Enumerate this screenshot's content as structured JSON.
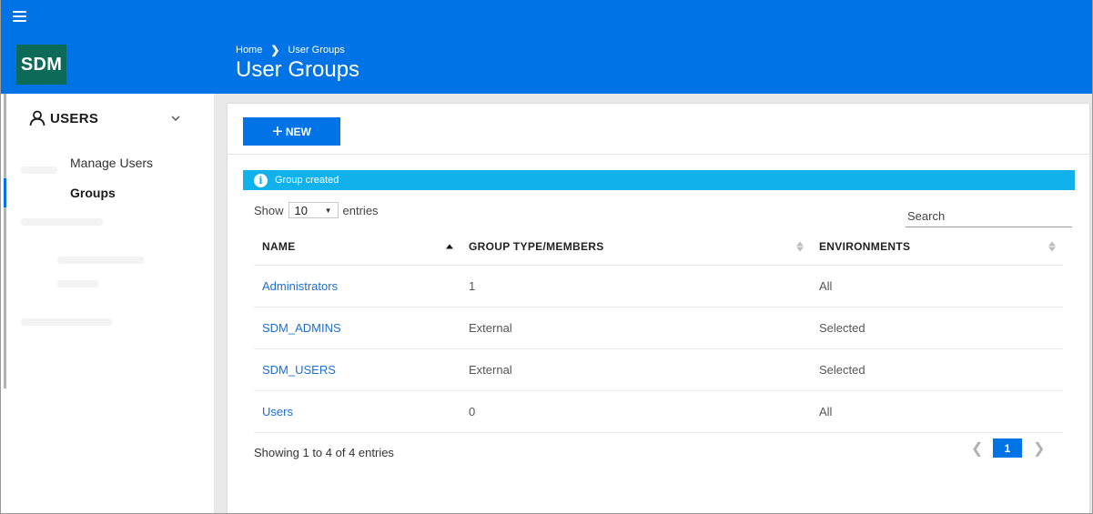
{
  "header": {
    "logo": "SDM",
    "breadcrumb": {
      "home": "Home",
      "current": "User Groups"
    },
    "title": "User Groups"
  },
  "sidebar": {
    "section_label": "USERS",
    "items": [
      {
        "label": "Manage Users",
        "active": false
      },
      {
        "label": "Groups",
        "active": true
      }
    ]
  },
  "toolbar": {
    "new_label": "NEW"
  },
  "alert": {
    "message": "Group created"
  },
  "length": {
    "show": "Show",
    "value": "10",
    "entries": "entries"
  },
  "search": {
    "placeholder": "Search"
  },
  "table": {
    "columns": [
      "NAME",
      "GROUP TYPE/MEMBERS",
      "ENVIRONMENTS"
    ],
    "rows": [
      {
        "name": "Administrators",
        "type": "1",
        "env": "All"
      },
      {
        "name": "SDM_ADMINS",
        "type": "External",
        "env": "Selected"
      },
      {
        "name": "SDM_USERS",
        "type": "External",
        "env": "Selected"
      },
      {
        "name": "Users",
        "type": "0",
        "env": "All"
      }
    ]
  },
  "footer": {
    "info": "Showing 1 to 4 of 4 entries",
    "current_page": "1"
  },
  "colors": {
    "primary": "#0073e6",
    "logo_bg": "#0b6a58",
    "alert": "#11b1ec",
    "link": "#1a6fd6"
  },
  "icons": {
    "menu": "hamburger-icon",
    "user": "user-icon",
    "chevron": "chevron-down-icon",
    "info": "info-icon"
  }
}
